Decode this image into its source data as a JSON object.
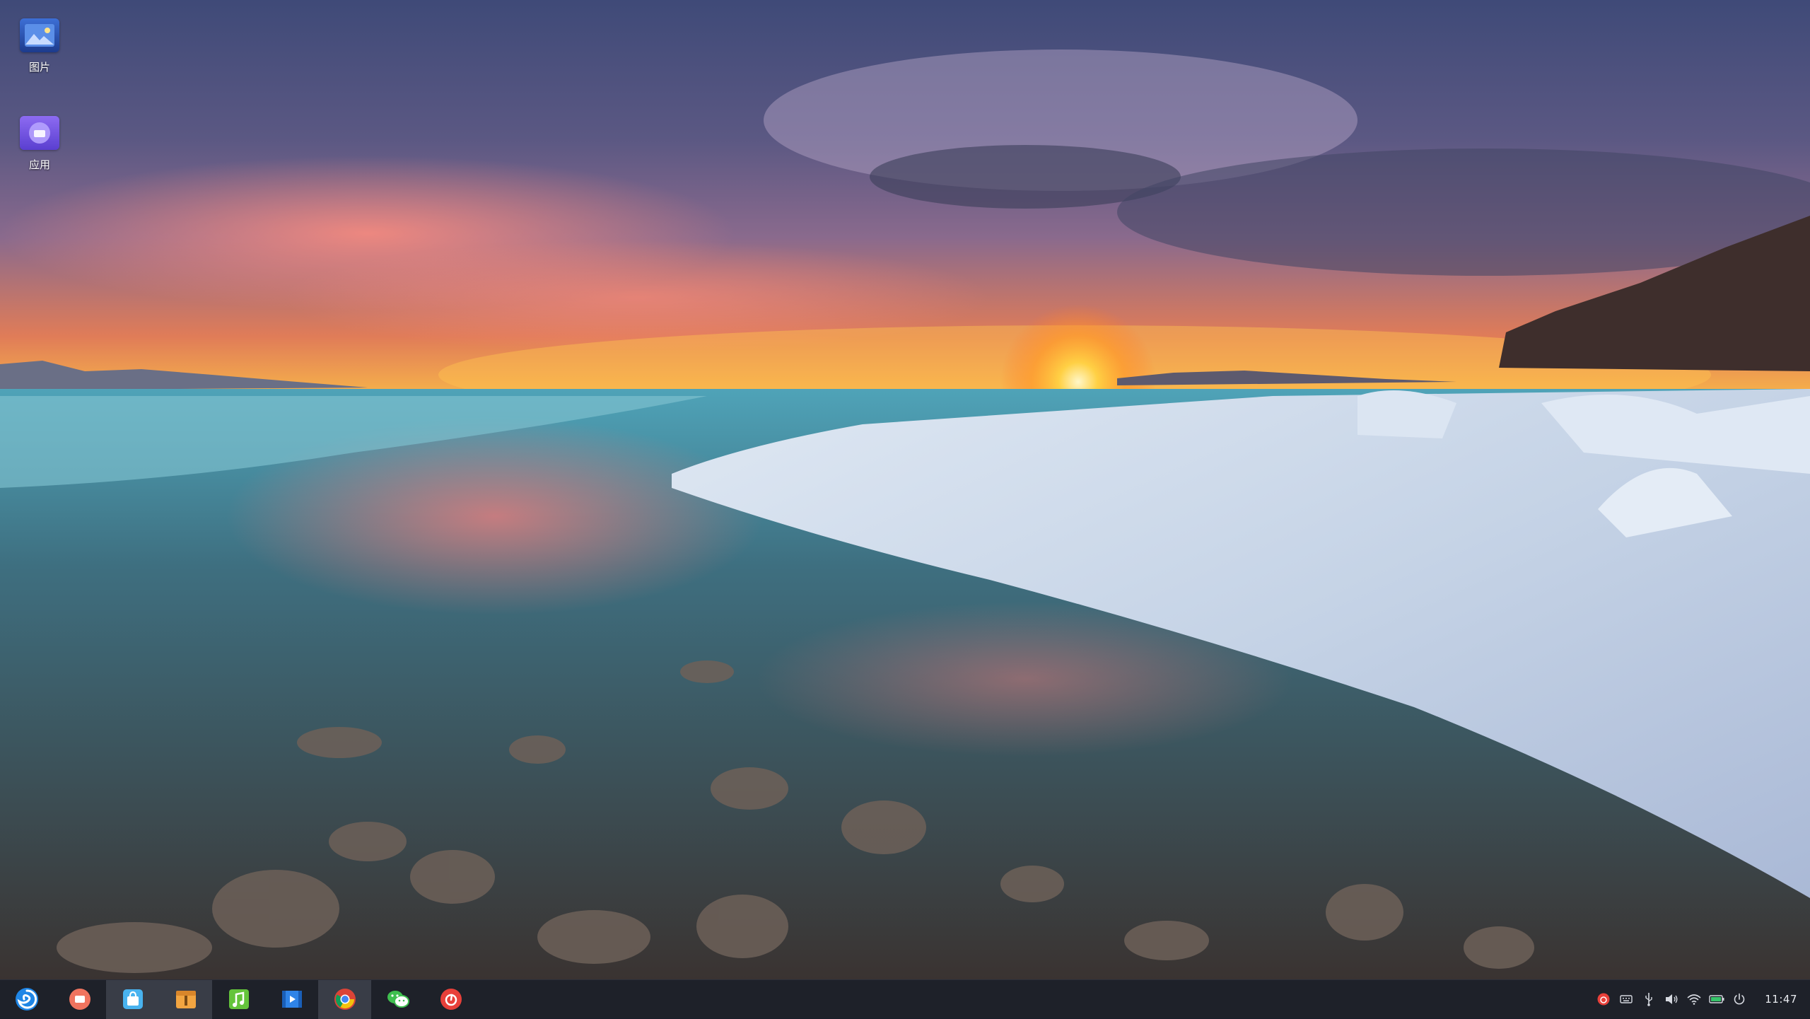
{
  "desktop": {
    "icons": [
      {
        "label": "图片",
        "icon": "pictures-icon"
      },
      {
        "label": "应用",
        "icon": "apps-icon"
      }
    ]
  },
  "taskbar": {
    "start_icon": "start-menu-icon",
    "apps": [
      {
        "icon": "screen-recorder-icon",
        "open": false
      },
      {
        "icon": "app-store-icon",
        "open": true
      },
      {
        "icon": "archive-manager-icon",
        "open": true
      },
      {
        "icon": "music-player-icon",
        "open": false
      },
      {
        "icon": "video-player-icon",
        "open": false
      },
      {
        "icon": "chrome-icon",
        "open": true
      },
      {
        "icon": "wechat-icon",
        "open": false
      },
      {
        "icon": "netease-music-icon",
        "open": false
      }
    ],
    "tray": [
      "netease-music-tray-icon",
      "keyboard-icon",
      "usb-icon",
      "volume-icon",
      "wifi-icon",
      "battery-icon",
      "power-icon"
    ],
    "clock": "11:47"
  },
  "colors": {
    "taskbar_bg": "#1e2129",
    "taskbar_active": "#393d47",
    "accent_red": "#e8403a"
  }
}
